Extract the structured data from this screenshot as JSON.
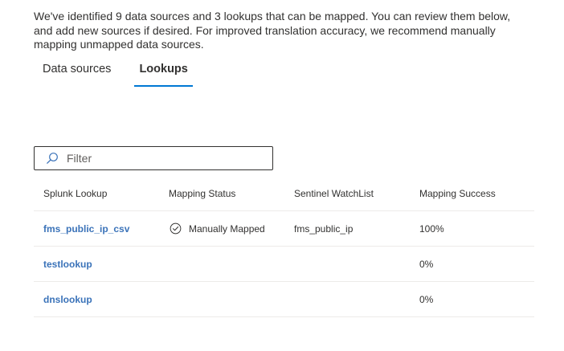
{
  "intro_text": "We've identified 9 data sources and 3 lookups that can be mapped. You can review them below, and add new sources if desired. For improved translation accuracy, we recommend manually mapping unmapped data sources.",
  "tabs": [
    {
      "label": "Data sources",
      "selected": false
    },
    {
      "label": "Lookups",
      "selected": true
    }
  ],
  "filter": {
    "placeholder": "Filter",
    "value": "",
    "icon": "search-icon"
  },
  "table": {
    "columns": [
      "Splunk Lookup",
      "Mapping Status",
      "Sentinel WatchList",
      "Mapping Success"
    ],
    "rows": [
      {
        "lookup": "fms_public_ip_csv",
        "status": "Manually Mapped",
        "status_icon": "check-circle-icon",
        "watchlist": "fms_public_ip",
        "success": "100%"
      },
      {
        "lookup": "testlookup",
        "status": "",
        "status_icon": "",
        "watchlist": "",
        "success": "0%"
      },
      {
        "lookup": "dnslookup",
        "status": "",
        "status_icon": "",
        "watchlist": "",
        "success": "0%"
      }
    ]
  },
  "colors": {
    "accent": "#0078d4",
    "link": "#3b73b9",
    "text": "#323130",
    "divider": "#edebe9"
  }
}
